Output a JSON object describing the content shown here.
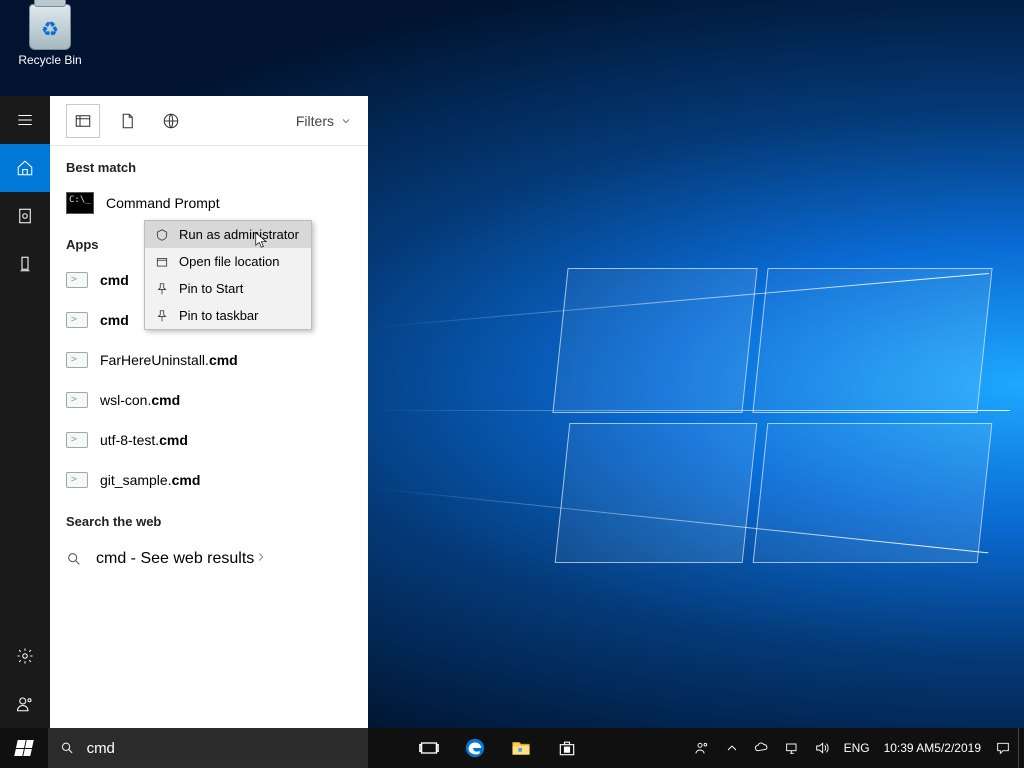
{
  "desktop": {
    "recycle_bin_label": "Recycle Bin"
  },
  "rail": {
    "items": [
      "menu",
      "home",
      "recent",
      "pc"
    ],
    "active": "home"
  },
  "search": {
    "filters_label": "Filters",
    "sections": {
      "best_match": "Best match",
      "apps": "Apps",
      "web": "Search the web"
    },
    "best_result": {
      "title": "Command Prompt"
    },
    "apps_list": [
      {
        "name": "cmd",
        "suffix": ""
      },
      {
        "name": "cmd",
        "suffix": ""
      },
      {
        "name_pre": "FarHereUninstall.",
        "name_bold": "cmd"
      },
      {
        "name_pre": "wsl-con.",
        "name_bold": "cmd"
      },
      {
        "name_pre": "utf-8-test.",
        "name_bold": "cmd"
      },
      {
        "name_pre": "git_sample.",
        "name_bold": "cmd"
      }
    ],
    "web": {
      "query": "cmd",
      "hint": " - See web results"
    },
    "query": "cmd"
  },
  "context_menu": {
    "items": [
      "Run as administrator",
      "Open file location",
      "Pin to Start",
      "Pin to taskbar"
    ],
    "hovered_index": 0
  },
  "taskbar": {
    "icons": [
      "task-view",
      "edge",
      "file-explorer",
      "store"
    ]
  },
  "tray": {
    "language": "ENG",
    "time": "10:39 AM",
    "date": "5/2/2019"
  }
}
